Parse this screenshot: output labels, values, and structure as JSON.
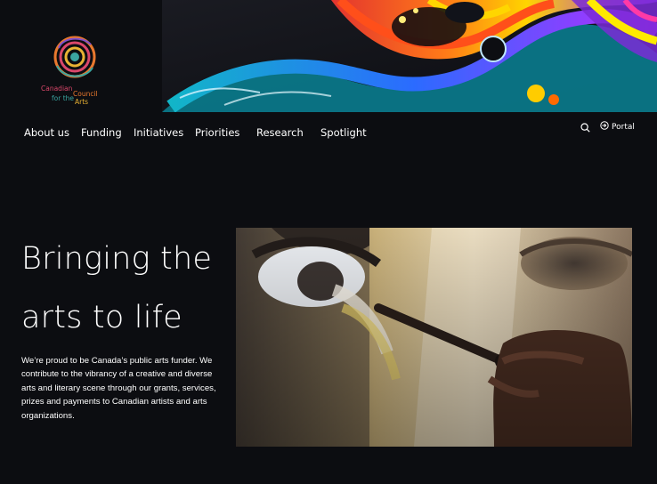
{
  "brand": {
    "logo_words": [
      "Canadian",
      "Council",
      "for the",
      "Arts"
    ]
  },
  "nav": {
    "items": [
      {
        "label": "About us"
      },
      {
        "label": "Funding"
      },
      {
        "label": "Initiatives"
      },
      {
        "label": "Priorities"
      },
      {
        "label": "Research"
      },
      {
        "label": "Spotlight"
      }
    ]
  },
  "tools": {
    "search_icon": "search-icon",
    "portal_label": "Portal",
    "portal_icon": "sign-in-icon"
  },
  "hero": {
    "title_line1": "Bringing the",
    "title_line2": "arts to life",
    "body": "We’re proud to be Canada’s public arts funder. We contribute to the vibrancy of a creative and diverse arts and literary scene through our grants, services, prizes and payments to Canadian artists and arts organizations."
  },
  "colors": {
    "background": "#0c0d11",
    "text": "#ffffff",
    "logo_pink": "#d9476a",
    "logo_orange": "#e8782e",
    "logo_teal": "#3aa5a0",
    "logo_yellow": "#e9b233"
  }
}
